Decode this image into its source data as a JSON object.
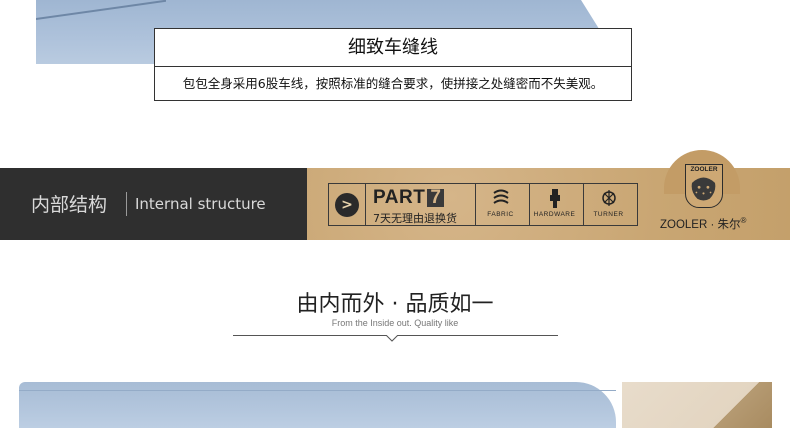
{
  "caption": {
    "title": "细致车缝线",
    "description": "包包全身采用6股车线，按照标准的缝合要求，使拼接之处缝密而不失美观。"
  },
  "banner": {
    "section_cn": "内部结构",
    "section_en": "Internal structure",
    "part_label": "PART",
    "part_number": "7",
    "part_sub": "7天无理由退换货",
    "badges": [
      "FABRIC",
      "HARDWARE",
      "TURNER"
    ],
    "brand_emblem": "ZOOLER",
    "brand_name": "ZOOLER · 朱尔",
    "brand_mark": "®"
  },
  "section": {
    "title": "由内而外 · 品质如一",
    "subtitle": "From the Inside out. Quality like"
  },
  "colors": {
    "leather_blue": "#a7bcd5",
    "banner_dark": "#2f2f2f",
    "kraft": "#c9a673"
  },
  "icons": {
    "arrow": "arrow-right-circle-icon",
    "fabric": "fabric-icon",
    "hardware": "hardware-icon",
    "turner": "turner-icon",
    "leopard": "leopard-emblem-icon"
  }
}
